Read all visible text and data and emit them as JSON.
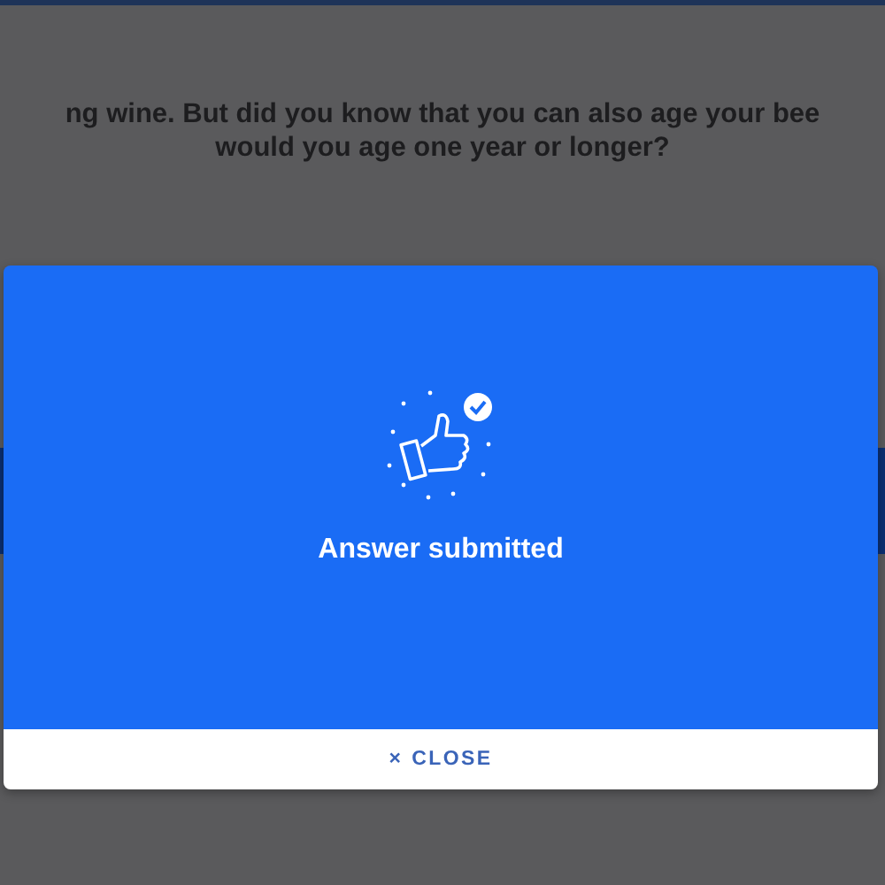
{
  "question": {
    "lines": [
      "ng wine. But did you know that you can also age your bee",
      "would you age one year or longer?"
    ]
  },
  "dialog": {
    "message": "Answer submitted",
    "close_button": {
      "icon": "×",
      "label": "CLOSE"
    }
  }
}
